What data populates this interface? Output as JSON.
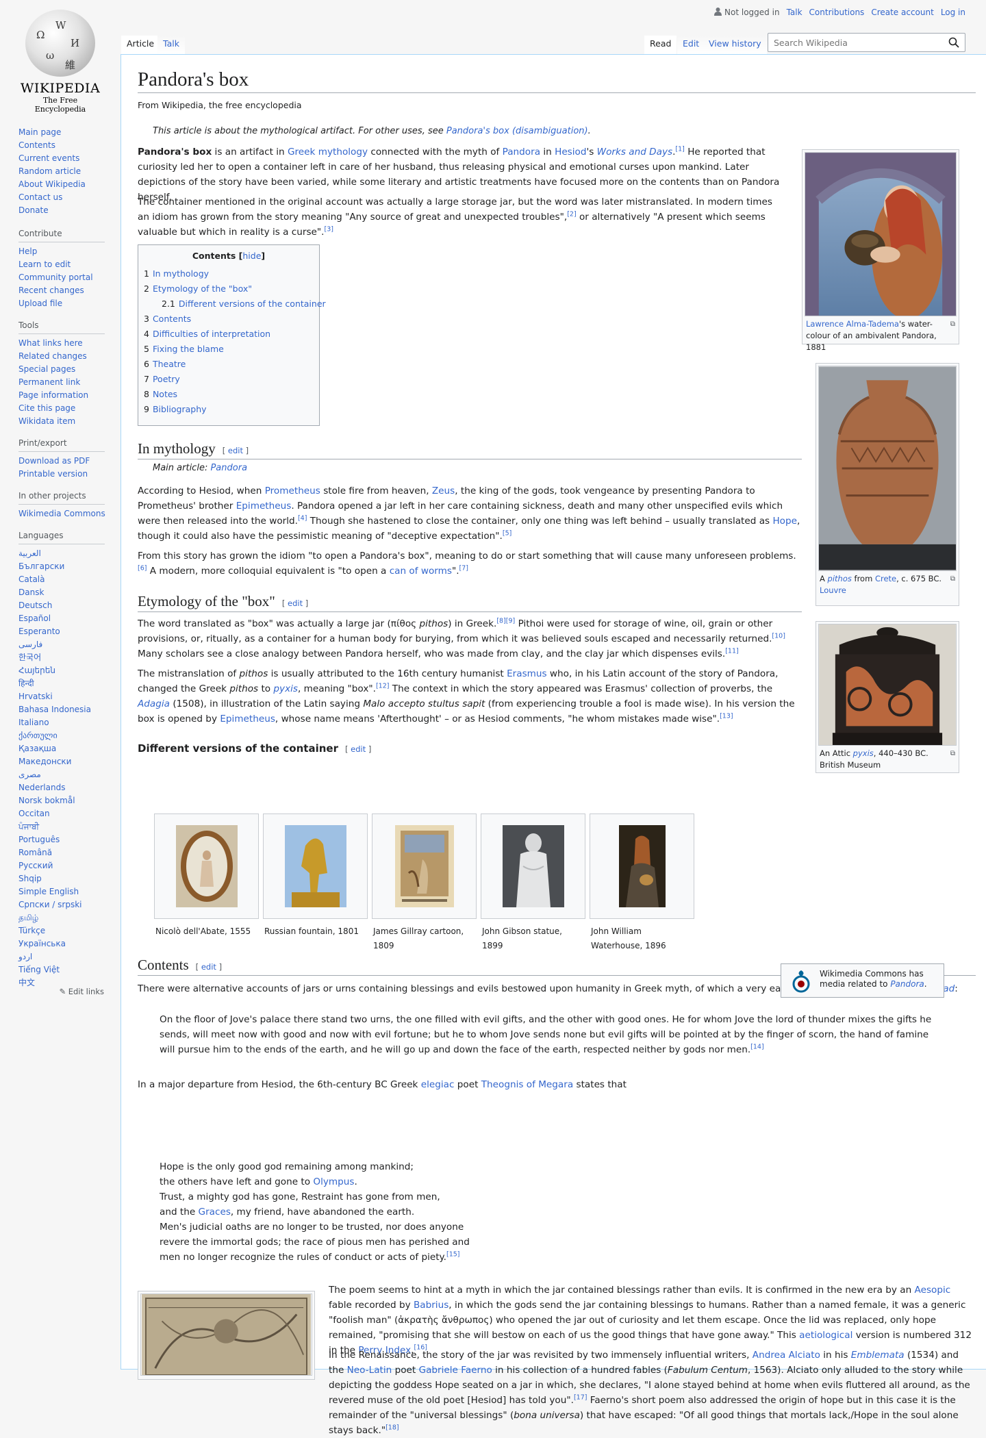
{
  "logo": {
    "wordmark": "WIKIPEDIA",
    "tagline": "The Free Encyclopedia"
  },
  "sidebar": {
    "navigation": [
      "Main page",
      "Contents",
      "Current events",
      "Random article",
      "About Wikipedia",
      "Contact us",
      "Donate"
    ],
    "contribute_heading": "Contribute",
    "contribute": [
      "Help",
      "Learn to edit",
      "Community portal",
      "Recent changes",
      "Upload file"
    ],
    "tools_heading": "Tools",
    "tools": [
      "What links here",
      "Related changes",
      "Special pages",
      "Permanent link",
      "Page information",
      "Cite this page",
      "Wikidata item"
    ],
    "print_heading": "Print/export",
    "print": [
      "Download as PDF",
      "Printable version"
    ],
    "projects_heading": "In other projects",
    "projects": [
      "Wikimedia Commons"
    ],
    "languages_heading": "Languages",
    "languages": [
      "العربية",
      "Български",
      "Català",
      "Dansk",
      "Deutsch",
      "Español",
      "Esperanto",
      "فارسی",
      "한국어",
      "Հայերեն",
      "हिन्दी",
      "Hrvatski",
      "Bahasa Indonesia",
      "Italiano",
      "ქართული",
      "Қазақша",
      "Македонски",
      "مصرى",
      "Nederlands",
      "Norsk bokmål",
      "Occitan",
      "ਪੰਜਾਬੀ",
      "Português",
      "Română",
      "Русский",
      "Shqip",
      "Simple English",
      "Српски / srpski",
      "தமிழ்",
      "Türkçe",
      "Українська",
      "اردو",
      "Tiếng Việt",
      "中文"
    ],
    "edit_links": "Edit links"
  },
  "personal": {
    "not_logged_in": "Not logged in",
    "talk": "Talk",
    "contributions": "Contributions",
    "create_account": "Create account",
    "log_in": "Log in"
  },
  "tabs": {
    "article": "Article",
    "talk": "Talk",
    "read": "Read",
    "edit": "Edit",
    "history": "View history"
  },
  "search": {
    "placeholder": "Search Wikipedia"
  },
  "article": {
    "title": "Pandora's box",
    "site_sub": "From Wikipedia, the free encyclopedia",
    "hatnote_pre": "This article is about the mythological artifact. For other uses, see ",
    "hatnote_link": "Pandora's box (disambiguation)",
    "hatnote_post": ".",
    "section_edit": "edit",
    "s1": "In mythology",
    "s2": "Etymology of the \"box\"",
    "s2_1": "Different versions of the container",
    "s3": "Contents",
    "main_article": "Main article:",
    "main_article_link": "Pandora"
  },
  "toc": {
    "title": "Contents",
    "hide": "hide",
    "items": [
      {
        "num": "1",
        "label": "In mythology"
      },
      {
        "num": "2",
        "label": "Etymology of the \"box\""
      },
      {
        "num": "2.1",
        "label": "Different versions of the container"
      },
      {
        "num": "3",
        "label": "Contents"
      },
      {
        "num": "4",
        "label": "Difficulties of interpretation"
      },
      {
        "num": "5",
        "label": "Fixing the blame"
      },
      {
        "num": "6",
        "label": "Theatre"
      },
      {
        "num": "7",
        "label": "Poetry"
      },
      {
        "num": "8",
        "label": "Notes"
      },
      {
        "num": "9",
        "label": "Bibliography"
      }
    ]
  },
  "thumbs": {
    "t1_link": "Lawrence Alma-Tadema",
    "t1_rest": "'s water-colour of an ambivalent Pandora, 1881",
    "t2_a": "A ",
    "t2_pithos": "pithos",
    "t2_b": " from ",
    "t2_crete": "Crete",
    "t2_c": ", c. 675 BC.",
    "t2_louvre": "Louvre",
    "t3_a": "An Attic ",
    "t3_pyxis": "pyxis",
    "t3_b": ", 440–430 BC. British Museum"
  },
  "gallery": [
    {
      "caption": "Nicolò dell'Abate, 1555"
    },
    {
      "caption": "Russian fountain, 1801"
    },
    {
      "caption": "James Gillray cartoon, 1809"
    },
    {
      "caption": "John Gibson statue, 1899"
    },
    {
      "caption": "John William Waterhouse, 1896"
    }
  ],
  "commons": {
    "text": "Wikimedia Commons has media related to ",
    "link": "Pandora",
    "end": "."
  },
  "poem": [
    "Hope is the only good god remaining among mankind;",
    "the others have left and gone to ",
    "Trust, a mighty god has gone, Restraint has gone from men,",
    "and the ",
    "Men's judicial oaths are no longer to be trusted, nor does anyone",
    "revere the immortal gods; the race of pious men has perished and",
    "men no longer recognize the rules of conduct or acts of piety."
  ],
  "colors": {
    "link": "#3366cc",
    "border": "#a7d7f9",
    "text": "#202122",
    "background": "#f6f6f6"
  }
}
